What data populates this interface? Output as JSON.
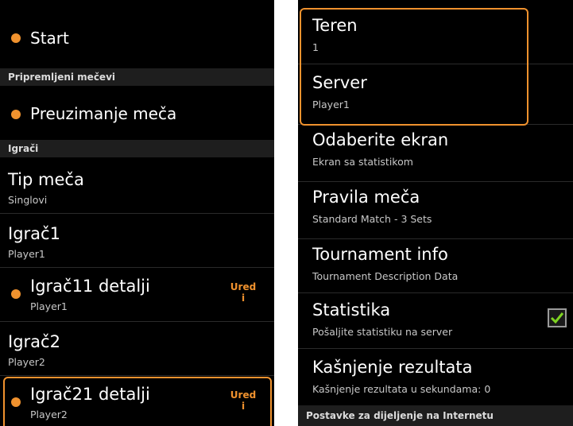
{
  "left": {
    "start": {
      "label": "Start"
    },
    "section_prepared": "Pripremljeni mečevi",
    "download": {
      "label": "Preuzimanje meča"
    },
    "section_players": "Igrači",
    "match_type": {
      "title": "Tip meča",
      "value": "Singlovi"
    },
    "player1": {
      "title": "Igrač1",
      "value": "Player1"
    },
    "player11": {
      "title": "Igrač11 detalji",
      "value": "Player1",
      "action": "Uredi"
    },
    "player2": {
      "title": "Igrač2",
      "value": "Player2"
    },
    "player21": {
      "title": "Igrač21 detalji",
      "value": "Player2",
      "action": "Uredi"
    }
  },
  "right": {
    "court": {
      "title": "Teren",
      "value": "1"
    },
    "server": {
      "title": "Server",
      "value": "Player1"
    },
    "screen": {
      "title": "Odaberite ekran",
      "value": "Ekran sa statistikom"
    },
    "rules": {
      "title": "Pravila meča",
      "value": "Standard Match - 3 Sets"
    },
    "tournament": {
      "title": "Tournament info",
      "value": "Tournament Description Data"
    },
    "stats": {
      "title": "Statistika",
      "value": "Pošaljite statistiku na server",
      "checked": true
    },
    "delay": {
      "title": "Kašnjenje rezultata",
      "value": "Kašnjenje rezultata u sekundama: 0"
    },
    "section_sharing": "Postavke za dijeljenje na Internetu"
  },
  "colors": {
    "accent": "#f0922e",
    "background": "#000000",
    "section": "#1e1e1e",
    "check": "#7ed321"
  },
  "icons": {
    "bullet": "orange-dot-icon",
    "checkbox": "checkmark-icon"
  }
}
